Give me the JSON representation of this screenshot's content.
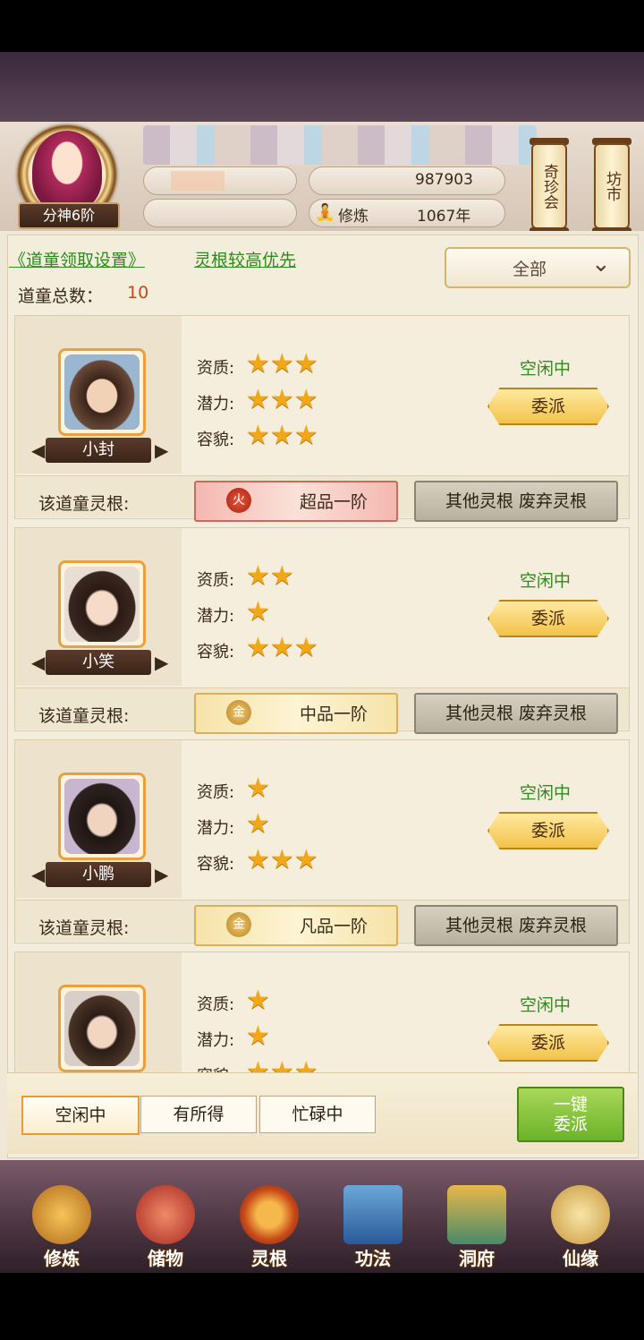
{
  "header": {
    "rank_badge": "分神6阶",
    "stat_value_1": "987903",
    "stat_label_2": "修炼",
    "stat_value_2": "1067年",
    "side_buttons": [
      "奇珍会",
      "坊市"
    ]
  },
  "settings": {
    "link_label": "《道童领取设置》",
    "priority_label": "灵根较高优先",
    "filter_selected": "全部",
    "total_label": "道童总数：",
    "total_value": "10"
  },
  "attr_labels": {
    "quality": "资质:",
    "potential": "潜力:",
    "looks": "容貌:"
  },
  "root_row_label": "该道童灵根:",
  "other_root_label": "其他灵根 废弃灵根",
  "dispatch_label": "委派",
  "disciples": [
    {
      "name": "小封",
      "status": "空闲中",
      "quality": 3,
      "potential": 3,
      "looks": 3,
      "root_element": "火",
      "root_grade": "超品一阶",
      "root_type": "fire"
    },
    {
      "name": "小笑",
      "status": "空闲中",
      "quality": 2,
      "potential": 1,
      "looks": 3,
      "root_element": "金",
      "root_grade": "中品一阶",
      "root_type": "gold"
    },
    {
      "name": "小鹏",
      "status": "空闲中",
      "quality": 1,
      "potential": 1,
      "looks": 3,
      "root_element": "金",
      "root_grade": "凡品一阶",
      "root_type": "gold"
    },
    {
      "name": "",
      "status": "空闲中",
      "quality": 1,
      "potential": 1,
      "looks": 3
    }
  ],
  "filter_tabs": [
    "空闲中",
    "有所得",
    "忙碌中"
  ],
  "one_click": {
    "line1": "一键",
    "line2": "委派"
  },
  "nav": [
    "修炼",
    "储物",
    "灵根",
    "功法",
    "洞府",
    "仙缘"
  ],
  "colors": {
    "status_green": "#2e8a1e",
    "star": "#f0a818",
    "fire": "#c93a2a",
    "gold": "#c99a2a"
  }
}
